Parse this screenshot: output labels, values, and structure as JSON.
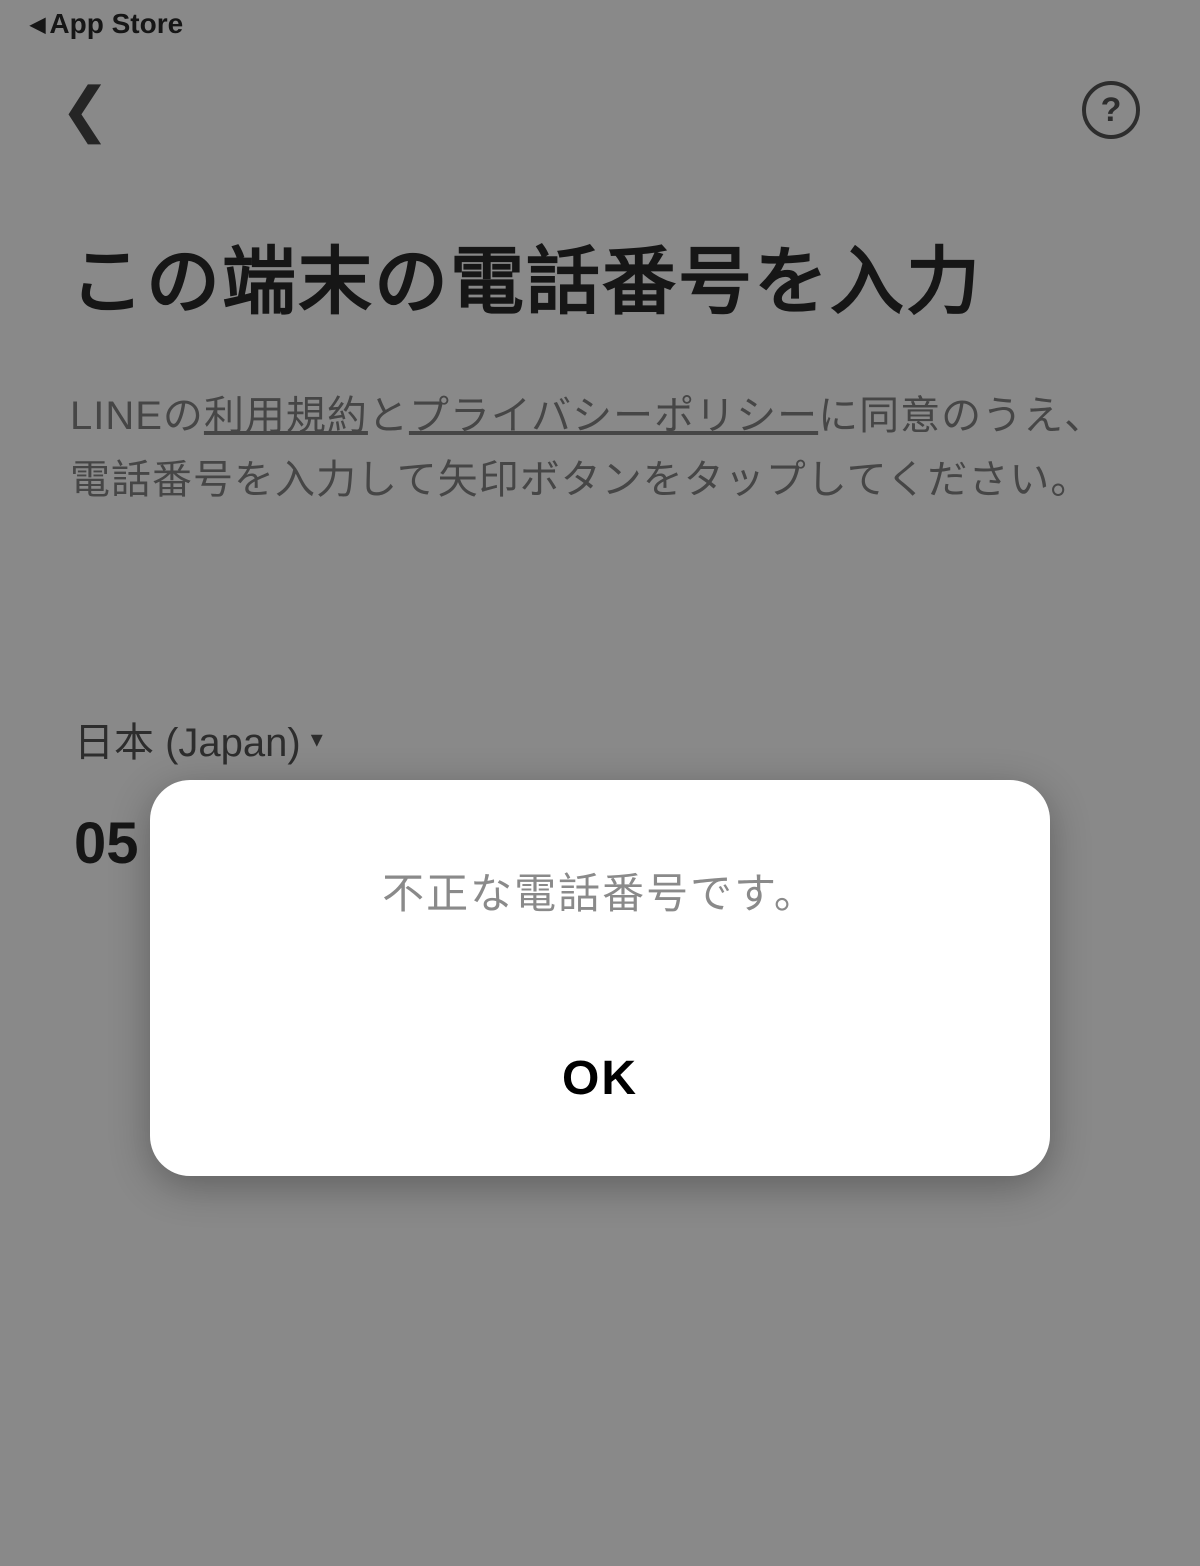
{
  "status": {
    "back_app": "App Store"
  },
  "nav": {
    "help_symbol": "?"
  },
  "main": {
    "title": "この端末の電話番号を入力",
    "desc_prefix": "LINEの",
    "terms_link": "利用規約",
    "desc_mid": "と",
    "privacy_link": "プライバシーポリシー",
    "desc_suffix": "に同意のうえ、電話番号を入力して矢印ボタンをタップしてください。"
  },
  "country": {
    "label": "日本 (Japan)"
  },
  "phone": {
    "value": "05"
  },
  "dialog": {
    "message": "不正な電話番号です。",
    "ok_label": "OK"
  }
}
